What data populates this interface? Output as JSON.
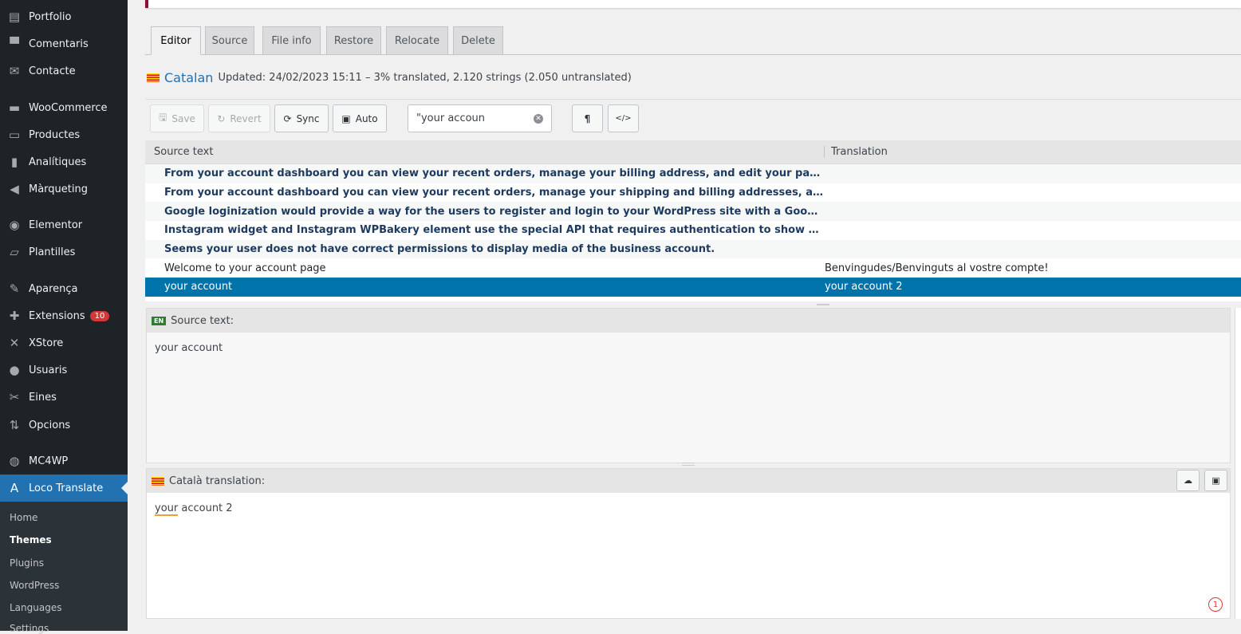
{
  "sidebar": {
    "items": [
      {
        "label": "Portfolio",
        "icon": "portfolio-icon",
        "glyph": "▤"
      },
      {
        "label": "Comentaris",
        "icon": "comment-icon",
        "glyph": "▀"
      },
      {
        "label": "Contacte",
        "icon": "mail-icon",
        "glyph": "✉"
      },
      {
        "label": "WooCommerce",
        "icon": "woo-icon",
        "glyph": "▬"
      },
      {
        "label": "Productes",
        "icon": "products-icon",
        "glyph": "▭"
      },
      {
        "label": "Analítiques",
        "icon": "chart-icon",
        "glyph": "▮"
      },
      {
        "label": "Màrqueting",
        "icon": "megaphone-icon",
        "glyph": "◀"
      },
      {
        "label": "Elementor",
        "icon": "elementor-icon",
        "glyph": "◉"
      },
      {
        "label": "Plantilles",
        "icon": "folder-icon",
        "glyph": "▱"
      },
      {
        "label": "Aparença",
        "icon": "brush-icon",
        "glyph": "✎"
      },
      {
        "label": "Extensions",
        "icon": "plugin-icon",
        "glyph": "✚",
        "badge": "10"
      },
      {
        "label": "XStore",
        "icon": "xstore-icon",
        "glyph": "✕"
      },
      {
        "label": "Usuaris",
        "icon": "user-icon",
        "glyph": "●"
      },
      {
        "label": "Eines",
        "icon": "wrench-icon",
        "glyph": "✂"
      },
      {
        "label": "Opcions",
        "icon": "settings-icon",
        "glyph": "⇅"
      },
      {
        "label": "MC4WP",
        "icon": "mc4wp-icon",
        "glyph": "◍"
      },
      {
        "label": "Loco Translate",
        "icon": "translate-icon",
        "glyph": "A"
      }
    ],
    "submenu": [
      "Home",
      "Themes",
      "Plugins",
      "WordPress",
      "Languages",
      "Settings"
    ]
  },
  "tabs": [
    "Editor",
    "Source",
    "File info",
    "Restore",
    "Relocate",
    "Delete"
  ],
  "header": {
    "language": "Catalan",
    "meta": "Updated: 24/02/2023 15:11 – 3% translated, 2.120 strings (2.050 untranslated)"
  },
  "toolbar": {
    "save": "Save",
    "revert": "Revert",
    "sync": "Sync",
    "auto": "Auto",
    "search_value": "\"your accoun"
  },
  "grid": {
    "col_source": "Source text",
    "col_translation": "Translation",
    "rows": [
      {
        "source": "From your account dashboard you can view your recent orders, manage your billing address, and edit your password and account details.",
        "translation": ""
      },
      {
        "source": "From your account dashboard you can view your recent orders, manage your shipping and billing addresses, and edit your password and account details.",
        "translation": ""
      },
      {
        "source": "Google loginization would provide a way for the users to register and login to your WordPress site with a Google account.",
        "translation": ""
      },
      {
        "source": "Instagram widget and Instagram WPBakery element use the special API that requires authentication to show your photos on any theme by default.",
        "translation": ""
      },
      {
        "source": "Seems your user does not have correct permissions to display media of the business account.",
        "translation": ""
      },
      {
        "source": "Welcome to your account page",
        "translation": "Benvingudes/Benvinguts al vostre compte!"
      },
      {
        "source": "your account",
        "translation": "your account 2"
      }
    ]
  },
  "source_pane": {
    "lang_code": "EN",
    "label": "Source text:",
    "text": "your account"
  },
  "translation_pane": {
    "label": "Català translation:",
    "text_underlined": "your",
    "text_rest": " account 2"
  },
  "alert_count": "1",
  "colors": {
    "accent": "#2271b1",
    "selected_row": "#0073aa",
    "sidebar": "#1d2327"
  }
}
